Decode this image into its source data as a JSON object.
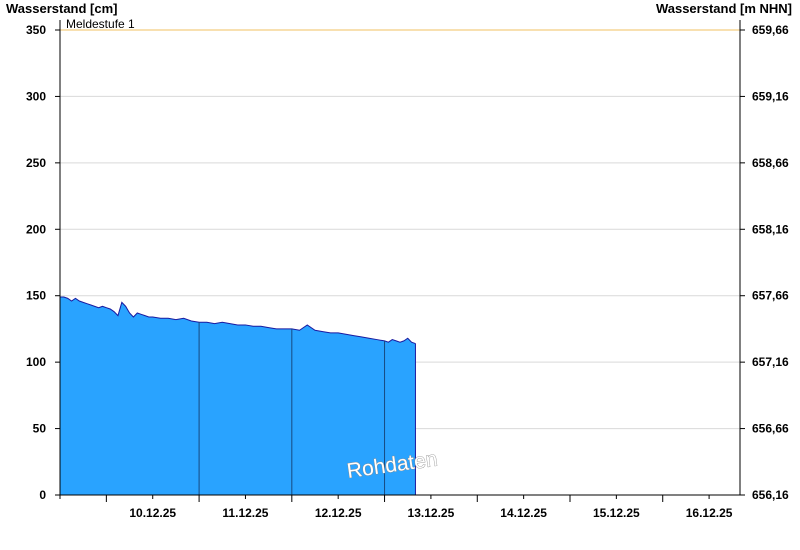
{
  "chart_data": {
    "type": "area",
    "ylabel": "Wasserstand [cm]",
    "ylabel_right": "Wasserstand [m NHN]",
    "ylim": [
      0,
      350
    ],
    "yticks": [
      "0",
      "50",
      "100",
      "150",
      "200",
      "250",
      "300",
      "350"
    ],
    "yticks_right": [
      "656,16",
      "656,66",
      "657,16",
      "657,66",
      "658,16",
      "658,66",
      "659,16",
      "659,66"
    ],
    "xlim": [
      "09.12.25 12:00",
      "16.12.25 20:00"
    ],
    "x_tick_labels": [
      "10.12.25",
      "11.12.25",
      "12.12.25",
      "13.12.25",
      "14.12.25",
      "15.12.25",
      "16.12.25"
    ],
    "grid": true,
    "threshold": {
      "label": "Meldestufe 1",
      "value": 350,
      "color": "#f0c060"
    },
    "watermark": "Rohdaten",
    "series": [
      {
        "color": "#29a3ff",
        "line_color": "#1a1aa0",
        "x": [
          "09.12.25 12:00",
          "09.12.25 13:00",
          "09.12.25 14:00",
          "09.12.25 15:00",
          "09.12.25 16:00",
          "09.12.25 17:00",
          "09.12.25 18:00",
          "09.12.25 19:00",
          "09.12.25 20:00",
          "09.12.25 21:00",
          "09.12.25 22:00",
          "09.12.25 23:00",
          "10.12.25 00:00",
          "10.12.25 01:00",
          "10.12.25 02:00",
          "10.12.25 03:00",
          "10.12.25 04:00",
          "10.12.25 05:00",
          "10.12.25 06:00",
          "10.12.25 07:00",
          "10.12.25 08:00",
          "10.12.25 09:00",
          "10.12.25 10:00",
          "10.12.25 11:00",
          "10.12.25 12:00",
          "10.12.25 14:00",
          "10.12.25 16:00",
          "10.12.25 18:00",
          "10.12.25 20:00",
          "10.12.25 22:00",
          "11.12.25 00:00",
          "11.12.25 02:00",
          "11.12.25 04:00",
          "11.12.25 06:00",
          "11.12.25 08:00",
          "11.12.25 10:00",
          "11.12.25 12:00",
          "11.12.25 14:00",
          "11.12.25 16:00",
          "11.12.25 18:00",
          "11.12.25 20:00",
          "11.12.25 22:00",
          "12.12.25 00:00",
          "12.12.25 02:00",
          "12.12.25 04:00",
          "12.12.25 06:00",
          "12.12.25 08:00",
          "12.12.25 10:00",
          "12.12.25 12:00",
          "12.12.25 14:00",
          "12.12.25 16:00",
          "12.12.25 18:00",
          "12.12.25 20:00",
          "12.12.25 22:00",
          "13.12.25 00:00",
          "13.12.25 01:00",
          "13.12.25 02:00",
          "13.12.25 03:00",
          "13.12.25 04:00",
          "13.12.25 05:00",
          "13.12.25 06:00",
          "13.12.25 07:00",
          "13.12.25 08:00"
        ],
        "values": [
          149,
          149,
          148,
          146,
          148,
          146,
          145,
          144,
          143,
          142,
          141,
          142,
          141,
          140,
          138,
          135,
          145,
          142,
          137,
          134,
          137,
          136,
          135,
          134,
          134,
          133,
          133,
          132,
          133,
          131,
          130,
          130,
          129,
          130,
          129,
          128,
          128,
          127,
          127,
          126,
          125,
          125,
          125,
          124,
          128,
          124,
          123,
          122,
          122,
          121,
          120,
          119,
          118,
          117,
          116,
          115,
          117,
          116,
          115,
          116,
          118,
          115,
          114
        ]
      }
    ]
  }
}
